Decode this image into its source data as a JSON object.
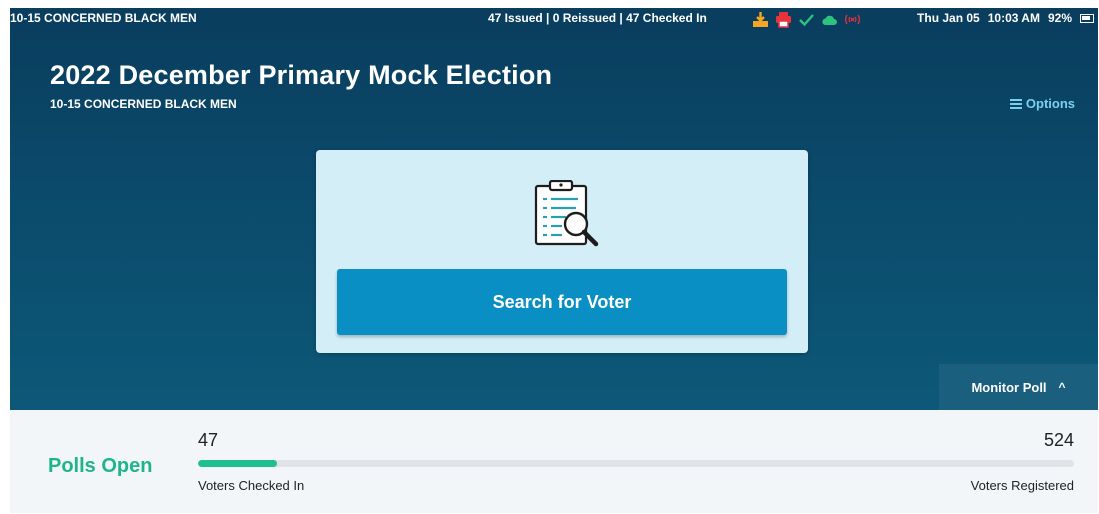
{
  "status_bar": {
    "precinct": "10-15 CONCERNED BLACK MEN",
    "counts": "47 Issued | 0 Reissued | 47 Checked In",
    "icons": [
      "download-icon",
      "printer-icon",
      "check-icon",
      "cloud-icon",
      "signal-off-icon"
    ],
    "date": "Thu Jan 05",
    "time": "10:03 AM",
    "battery": "92%"
  },
  "header": {
    "title": "2022 December Primary Mock Election",
    "subtitle": "10-15 CONCERNED BLACK MEN",
    "options_label": "Options"
  },
  "card": {
    "icon": "clipboard-search-icon",
    "search_button_label": "Search for Voter"
  },
  "monitor": {
    "label": "Monitor Poll",
    "caret": "^"
  },
  "footer": {
    "status": "Polls Open",
    "checked_in": "47",
    "registered": "524",
    "checked_in_label": "Voters Checked In",
    "registered_label": "Voters Registered",
    "progress_fraction": 0.0897
  },
  "colors": {
    "accent": "#0a8fc4",
    "success": "#1fb58a",
    "header_bg": "#0b4a6b",
    "options_link": "#7ad0f0"
  }
}
